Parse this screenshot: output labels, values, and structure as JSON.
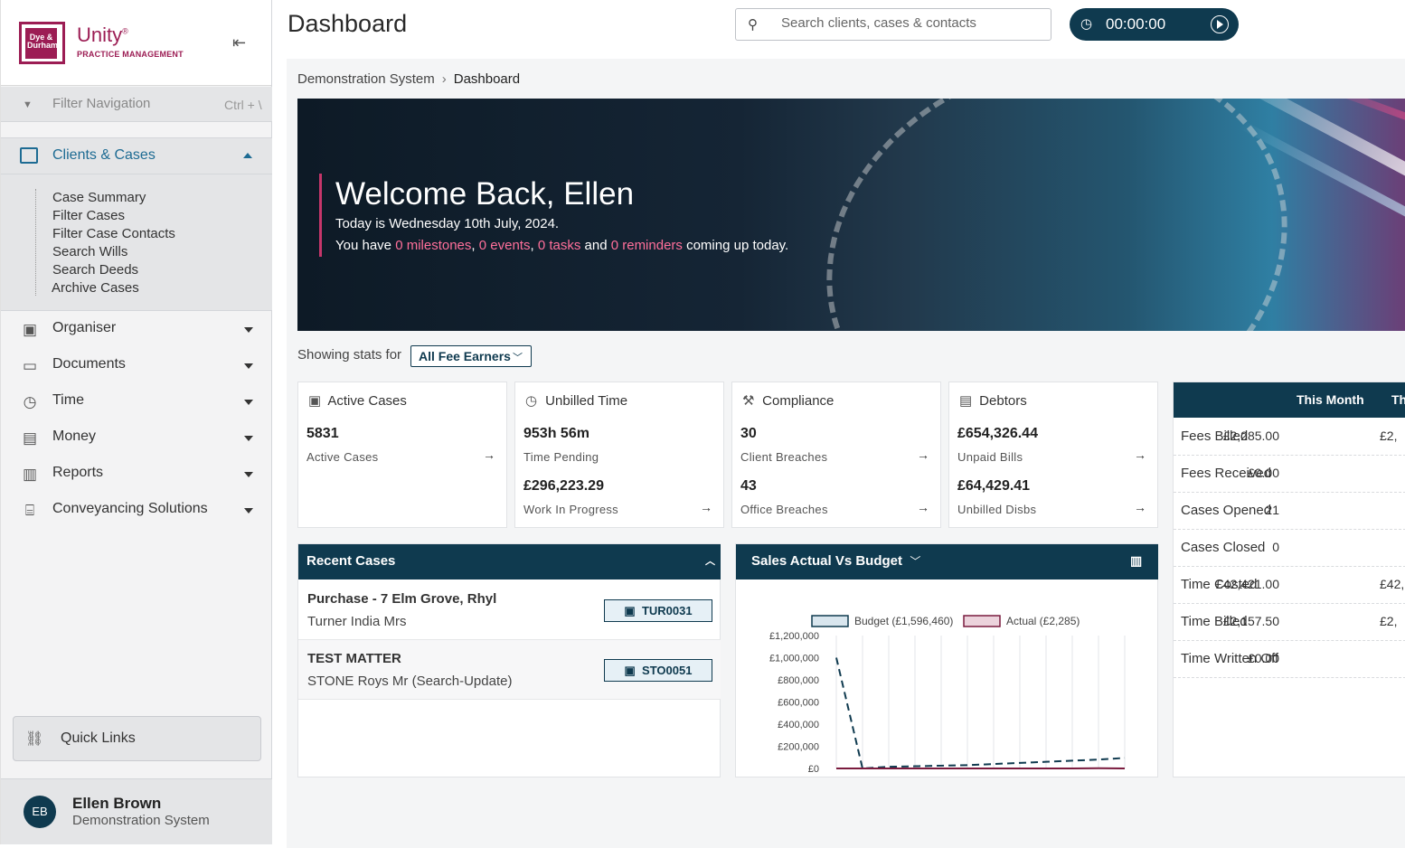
{
  "app": {
    "brand_small": "Dye & Durham",
    "brand": "Unity",
    "brand_reg": "®",
    "brand_sub": "PRACTICE MANAGEMENT"
  },
  "nav": {
    "filter_placeholder": "Filter Navigation",
    "filter_shortcut": "Ctrl + \\",
    "open_section": "Clients & Cases",
    "subitems": [
      "Case Summary",
      "Filter Cases",
      "Filter Case Contacts",
      "Search Wills",
      "Search Deeds",
      "Archive Cases"
    ],
    "items": [
      "Organiser",
      "Documents",
      "Time",
      "Money",
      "Reports",
      "Conveyancing Solutions"
    ],
    "quick_links": "Quick Links"
  },
  "user": {
    "initials": "EB",
    "name": "Ellen Brown",
    "org": "Demonstration System"
  },
  "header": {
    "title": "Dashboard",
    "search_placeholder": "Search clients, cases & contacts",
    "timer": "00:00:00"
  },
  "breadcrumb": {
    "root": "Demonstration System",
    "sep": "›",
    "current": "Dashboard"
  },
  "banner": {
    "welcome": "Welcome Back, Ellen",
    "today": "Today is Wednesday 10th July, 2024.",
    "you_have": "You have",
    "milestones": "0 milestones",
    "c1": ",",
    "events": "0 events",
    "c2": ",",
    "tasks": "0 tasks",
    "and": "and",
    "reminders": "0 reminders",
    "suffix": "coming up today."
  },
  "stats": {
    "label": "Showing stats for",
    "selected": "All Fee Earners"
  },
  "cards": {
    "active": {
      "title": "Active Cases",
      "v1": "5831",
      "l1": "Active Cases"
    },
    "unbilled": {
      "title": "Unbilled Time",
      "v1": "953h 56m",
      "l1": "Time Pending",
      "v2": "£296,223.29",
      "l2": "Work In Progress"
    },
    "compliance": {
      "title": "Compliance",
      "v1": "30",
      "l1": "Client Breaches",
      "v2": "43",
      "l2": "Office Breaches"
    },
    "debtors": {
      "title": "Debtors",
      "v1": "£654,326.44",
      "l1": "Unpaid Bills",
      "v2": "£64,429.41",
      "l2": "Unbilled Disbs"
    }
  },
  "summary": {
    "headers": [
      "This Month",
      "Th"
    ],
    "rows": [
      {
        "label": "Fees Billed",
        "v": "£2,285.00",
        "v2": "£2,"
      },
      {
        "label": "Fees Received",
        "v": "£0.00",
        "v2": ""
      },
      {
        "label": "Cases Opened",
        "v": "21",
        "v2": ""
      },
      {
        "label": "Cases Closed",
        "v": "0",
        "v2": ""
      },
      {
        "label": "Time Costed",
        "v": "£42,421.00",
        "v2": "£42,"
      },
      {
        "label": "Time Billed",
        "v": "£2,157.50",
        "v2": "£2,"
      },
      {
        "label": "Time Written Off",
        "v": "£0.00",
        "v2": ""
      }
    ]
  },
  "recent": {
    "title": "Recent Cases",
    "cases": [
      {
        "title": "Purchase - 7 Elm Grove, Rhyl",
        "client": "Turner India Mrs",
        "ref": "TUR0031"
      },
      {
        "title": "TEST MATTER",
        "client": "STONE Roys Mr (Search-Update)",
        "ref": "STO0051"
      }
    ]
  },
  "chart_data": {
    "type": "line",
    "title": "Sales Actual Vs Budget",
    "yticks": [
      "£1,200,000",
      "£1,000,000",
      "£800,000",
      "£600,000",
      "£400,000",
      "£200,000",
      "£0"
    ],
    "ylim": [
      0,
      1200000
    ],
    "series": [
      {
        "name": "Budget (£1,596,460)",
        "color": "#0f3a4f",
        "style": "dashed",
        "values": [
          1000000,
          0,
          15000,
          20000,
          25000,
          30000,
          40000,
          50000,
          60000,
          70000,
          80000,
          95000
        ]
      },
      {
        "name": "Actual (£2,285)",
        "color": "#7a1b3e",
        "style": "solid",
        "values": [
          0,
          0,
          0,
          0,
          0,
          0,
          0,
          0,
          0,
          0,
          2285,
          0
        ]
      }
    ]
  }
}
